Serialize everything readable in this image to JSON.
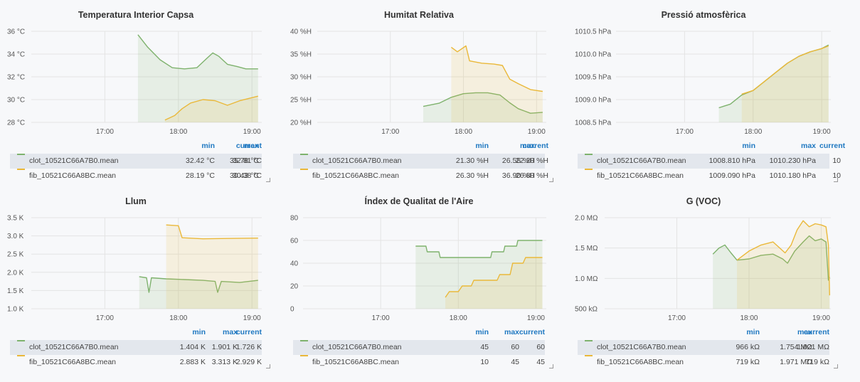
{
  "colors": {
    "green": "#7eb26d",
    "yellow": "#eab839",
    "header": "#1f78c1"
  },
  "panels": [
    {
      "title": "Temperatura Interior Capsa",
      "legend": {
        "cols": [
          "min",
          "max",
          "current"
        ],
        "rows": [
          {
            "name": "clot_10521C66A7B0.mean",
            "color": "green",
            "values": [
              "32.42 °C",
              "35.78 °C",
              "32.81 °C"
            ]
          },
          {
            "name": "fib_10521C66A8BC.mean",
            "color": "yellow",
            "values": [
              "28.19 °C",
              "30.43 °C",
              "30.38 °C"
            ]
          }
        ]
      },
      "chart_data": {
        "type": "area",
        "title": "Temperatura Interior Capsa",
        "x_ticks": [
          "17:00",
          "18:00",
          "19:00"
        ],
        "x_range": [
          "16:00",
          "19:08"
        ],
        "y_ticks": [
          "28 °C",
          "30 °C",
          "32 °C",
          "34 °C",
          "36 °C"
        ],
        "ylim": [
          28,
          36
        ],
        "series": [
          {
            "name": "clot_10521C66A7B0.mean",
            "color": "green",
            "points": [
              [
                "17:27",
                35.7
              ],
              [
                "17:35",
                34.6
              ],
              [
                "17:45",
                33.5
              ],
              [
                "17:55",
                32.8
              ],
              [
                "18:05",
                32.7
              ],
              [
                "18:15",
                32.8
              ],
              [
                "18:23",
                33.6
              ],
              [
                "18:28",
                34.1
              ],
              [
                "18:33",
                33.8
              ],
              [
                "18:40",
                33.1
              ],
              [
                "18:48",
                32.9
              ],
              [
                "18:55",
                32.7
              ],
              [
                "19:05",
                32.7
              ]
            ]
          },
          {
            "name": "fib_10521C66A8BC.mean",
            "color": "yellow",
            "points": [
              [
                "17:49",
                28.2
              ],
              [
                "17:57",
                28.6
              ],
              [
                "18:03",
                29.2
              ],
              [
                "18:10",
                29.7
              ],
              [
                "18:20",
                30.0
              ],
              [
                "18:30",
                29.9
              ],
              [
                "18:40",
                29.5
              ],
              [
                "18:50",
                29.9
              ],
              [
                "19:05",
                30.3
              ]
            ]
          }
        ]
      }
    },
    {
      "title": "Humitat Relativa",
      "legend": {
        "cols": [
          "min",
          "max",
          "current"
        ],
        "rows": [
          {
            "name": "clot_10521C66A7B0.mean",
            "color": "green",
            "values": [
              "21.30 %H",
              "26.55 %H",
              "22.20 %H"
            ]
          },
          {
            "name": "fib_10521C66A8BC.mean",
            "color": "yellow",
            "values": [
              "26.30 %H",
              "36.90 %H",
              "26.80 %H"
            ]
          }
        ]
      },
      "chart_data": {
        "type": "area",
        "title": "Humitat Relativa",
        "x_ticks": [
          "17:00",
          "18:00",
          "19:00"
        ],
        "x_range": [
          "16:00",
          "19:08"
        ],
        "y_ticks": [
          "20 %H",
          "25 %H",
          "30 %H",
          "35 %H",
          "40 %H"
        ],
        "ylim": [
          20,
          40
        ],
        "series": [
          {
            "name": "clot_10521C66A7B0.mean",
            "color": "green",
            "points": [
              [
                "17:27",
                23.5
              ],
              [
                "17:40",
                24.2
              ],
              [
                "17:50",
                25.5
              ],
              [
                "18:00",
                26.3
              ],
              [
                "18:10",
                26.5
              ],
              [
                "18:20",
                26.5
              ],
              [
                "18:30",
                26.0
              ],
              [
                "18:38",
                24.3
              ],
              [
                "18:45",
                23.0
              ],
              [
                "18:50",
                22.5
              ],
              [
                "18:55",
                22.0
              ],
              [
                "19:05",
                22.2
              ]
            ]
          },
          {
            "name": "fib_10521C66A8BC.mean",
            "color": "yellow",
            "points": [
              [
                "17:50",
                36.5
              ],
              [
                "17:55",
                35.5
              ],
              [
                "18:02",
                36.8
              ],
              [
                "18:05",
                33.5
              ],
              [
                "18:15",
                33.0
              ],
              [
                "18:25",
                32.8
              ],
              [
                "18:32",
                32.5
              ],
              [
                "18:38",
                29.5
              ],
              [
                "18:45",
                28.5
              ],
              [
                "18:55",
                27.2
              ],
              [
                "19:05",
                26.8
              ]
            ]
          }
        ]
      }
    },
    {
      "title": "Pressió atmosfèrica",
      "legend": {
        "cols": [
          "min",
          "max",
          "current"
        ],
        "rows": [
          {
            "name": "clot_10521C66A7B0.mean",
            "color": "green",
            "values": [
              "1008.810 hPa",
              "1010.230 hPa",
              "10"
            ]
          },
          {
            "name": "fib_10521C66A8BC.mean",
            "color": "yellow",
            "values": [
              "1009.090 hPa",
              "1010.180 hPa",
              "10"
            ]
          }
        ]
      },
      "chart_data": {
        "type": "area",
        "title": "Pressió atmosfèrica",
        "x_ticks": [
          "17:00",
          "18:00",
          "19:00"
        ],
        "x_range": [
          "16:00",
          "19:08"
        ],
        "y_ticks": [
          "1008.5 hPa",
          "1009.0 hPa",
          "1009.5 hPa",
          "1010.0 hPa",
          "1010.5 hPa"
        ],
        "ylim": [
          1008.5,
          1010.5
        ],
        "series": [
          {
            "name": "clot_10521C66A7B0.mean",
            "color": "green",
            "points": [
              [
                "17:30",
                1008.82
              ],
              [
                "17:40",
                1008.9
              ],
              [
                "17:50",
                1009.1
              ],
              [
                "18:00",
                1009.2
              ],
              [
                "18:10",
                1009.4
              ],
              [
                "18:20",
                1009.6
              ],
              [
                "18:30",
                1009.8
              ],
              [
                "18:40",
                1009.95
              ],
              [
                "18:50",
                1010.05
              ],
              [
                "19:00",
                1010.12
              ],
              [
                "19:06",
                1010.2
              ]
            ]
          },
          {
            "name": "fib_10521C66A8BC.mean",
            "color": "yellow",
            "points": [
              [
                "17:50",
                1009.12
              ],
              [
                "18:00",
                1009.2
              ],
              [
                "18:10",
                1009.4
              ],
              [
                "18:20",
                1009.6
              ],
              [
                "18:30",
                1009.8
              ],
              [
                "18:40",
                1009.95
              ],
              [
                "18:50",
                1010.05
              ],
              [
                "19:00",
                1010.12
              ],
              [
                "19:06",
                1010.18
              ]
            ]
          }
        ]
      }
    },
    {
      "title": "Llum",
      "legend": {
        "cols": [
          "min",
          "max",
          "current"
        ],
        "rows": [
          {
            "name": "clot_10521C66A7B0.mean",
            "color": "green",
            "values": [
              "1.404 K",
              "1.901 K",
              "1.726 K"
            ]
          },
          {
            "name": "fib_10521C66A8BC.mean",
            "color": "yellow",
            "values": [
              "2.883 K",
              "3.313 K",
              "2.929 K"
            ]
          }
        ]
      },
      "chart_data": {
        "type": "area",
        "title": "Llum",
        "x_ticks": [
          "17:00",
          "18:00",
          "19:00"
        ],
        "x_range": [
          "16:00",
          "19:08"
        ],
        "y_ticks": [
          "1.0 K",
          "1.5 K",
          "2.0 K",
          "2.5 K",
          "3.0 K",
          "3.5 K"
        ],
        "ylim": [
          1.0,
          3.5
        ],
        "series": [
          {
            "name": "clot_10521C66A7B0.mean",
            "color": "green",
            "points": [
              [
                "17:28",
                1.88
              ],
              [
                "17:34",
                1.85
              ],
              [
                "17:36",
                1.45
              ],
              [
                "17:38",
                1.85
              ],
              [
                "17:50",
                1.82
              ],
              [
                "18:05",
                1.8
              ],
              [
                "18:20",
                1.78
              ],
              [
                "18:30",
                1.75
              ],
              [
                "18:32",
                1.45
              ],
              [
                "18:35",
                1.75
              ],
              [
                "18:50",
                1.72
              ],
              [
                "19:05",
                1.78
              ]
            ]
          },
          {
            "name": "fib_10521C66A8BC.mean",
            "color": "yellow",
            "points": [
              [
                "17:50",
                3.3
              ],
              [
                "18:00",
                3.28
              ],
              [
                "18:03",
                2.95
              ],
              [
                "18:20",
                2.92
              ],
              [
                "18:40",
                2.93
              ],
              [
                "19:05",
                2.94
              ]
            ]
          }
        ]
      }
    },
    {
      "title": "Índex de Qualitat de l'Aire",
      "legend": {
        "cols": [
          "min",
          "max",
          "current"
        ],
        "rows": [
          {
            "name": "clot_10521C66A7B0.mean",
            "color": "green",
            "values": [
              "45",
              "60",
              "60"
            ]
          },
          {
            "name": "fib_10521C66A8BC.mean",
            "color": "yellow",
            "values": [
              "10",
              "45",
              "45"
            ]
          }
        ]
      },
      "chart_data": {
        "type": "area",
        "title": "Índex de Qualitat de l'Aire",
        "x_ticks": [
          "17:00",
          "18:00",
          "19:00"
        ],
        "x_range": [
          "16:00",
          "19:08"
        ],
        "y_ticks": [
          "0",
          "20",
          "40",
          "60",
          "80"
        ],
        "ylim": [
          0,
          80
        ],
        "series": [
          {
            "name": "clot_10521C66A7B0.mean",
            "color": "green",
            "points": [
              [
                "17:27",
                55
              ],
              [
                "17:35",
                55
              ],
              [
                "17:36",
                50
              ],
              [
                "17:45",
                50
              ],
              [
                "17:46",
                45
              ],
              [
                "18:25",
                45
              ],
              [
                "18:26",
                50
              ],
              [
                "18:35",
                50
              ],
              [
                "18:36",
                55
              ],
              [
                "18:45",
                55
              ],
              [
                "18:46",
                60
              ],
              [
                "19:05",
                60
              ]
            ]
          },
          {
            "name": "fib_10521C66A8BC.mean",
            "color": "yellow",
            "points": [
              [
                "17:50",
                10
              ],
              [
                "17:53",
                15
              ],
              [
                "18:00",
                15
              ],
              [
                "18:03",
                20
              ],
              [
                "18:10",
                20
              ],
              [
                "18:12",
                25
              ],
              [
                "18:30",
                25
              ],
              [
                "18:32",
                30
              ],
              [
                "18:40",
                30
              ],
              [
                "18:42",
                40
              ],
              [
                "18:50",
                40
              ],
              [
                "18:52",
                45
              ],
              [
                "19:05",
                45
              ]
            ]
          }
        ]
      }
    },
    {
      "title": "G (VOC)",
      "legend": {
        "cols": [
          "min",
          "max",
          "current"
        ],
        "rows": [
          {
            "name": "clot_10521C66A7B0.mean",
            "color": "green",
            "values": [
              "966 kΩ",
              "1.754 MΩ",
              "1.021 MΩ"
            ]
          },
          {
            "name": "fib_10521C66A8BC.mean",
            "color": "yellow",
            "values": [
              "719 kΩ",
              "1.971 MΩ",
              "719 kΩ"
            ]
          }
        ]
      },
      "chart_data": {
        "type": "area",
        "title": "G (VOC)",
        "x_ticks": [
          "17:00",
          "18:00",
          "19:00"
        ],
        "x_range": [
          "16:00",
          "19:08"
        ],
        "y_ticks": [
          "500 kΩ",
          "1.0 MΩ",
          "1.5 MΩ",
          "2.0 MΩ"
        ],
        "ylim": [
          0.5,
          2.0
        ],
        "series": [
          {
            "name": "clot_10521C66A7B0.mean",
            "color": "green",
            "points": [
              [
                "17:30",
                1.4
              ],
              [
                "17:35",
                1.5
              ],
              [
                "17:40",
                1.55
              ],
              [
                "17:45",
                1.42
              ],
              [
                "17:50",
                1.3
              ],
              [
                "18:00",
                1.32
              ],
              [
                "18:10",
                1.38
              ],
              [
                "18:20",
                1.4
              ],
              [
                "18:28",
                1.32
              ],
              [
                "18:32",
                1.25
              ],
              [
                "18:38",
                1.45
              ],
              [
                "18:45",
                1.6
              ],
              [
                "18:50",
                1.7
              ],
              [
                "18:55",
                1.62
              ],
              [
                "19:00",
                1.65
              ],
              [
                "19:04",
                1.6
              ],
              [
                "19:06",
                0.97
              ],
              [
                "19:07",
                1.02
              ]
            ]
          },
          {
            "name": "fib_10521C66A8BC.mean",
            "color": "yellow",
            "points": [
              [
                "17:50",
                1.3
              ],
              [
                "18:00",
                1.45
              ],
              [
                "18:10",
                1.55
              ],
              [
                "18:20",
                1.6
              ],
              [
                "18:30",
                1.42
              ],
              [
                "18:35",
                1.55
              ],
              [
                "18:40",
                1.8
              ],
              [
                "18:45",
                1.95
              ],
              [
                "18:50",
                1.85
              ],
              [
                "18:55",
                1.9
              ],
              [
                "19:00",
                1.88
              ],
              [
                "19:04",
                1.85
              ],
              [
                "19:06",
                1.55
              ],
              [
                "19:07",
                0.72
              ]
            ]
          }
        ]
      }
    }
  ]
}
